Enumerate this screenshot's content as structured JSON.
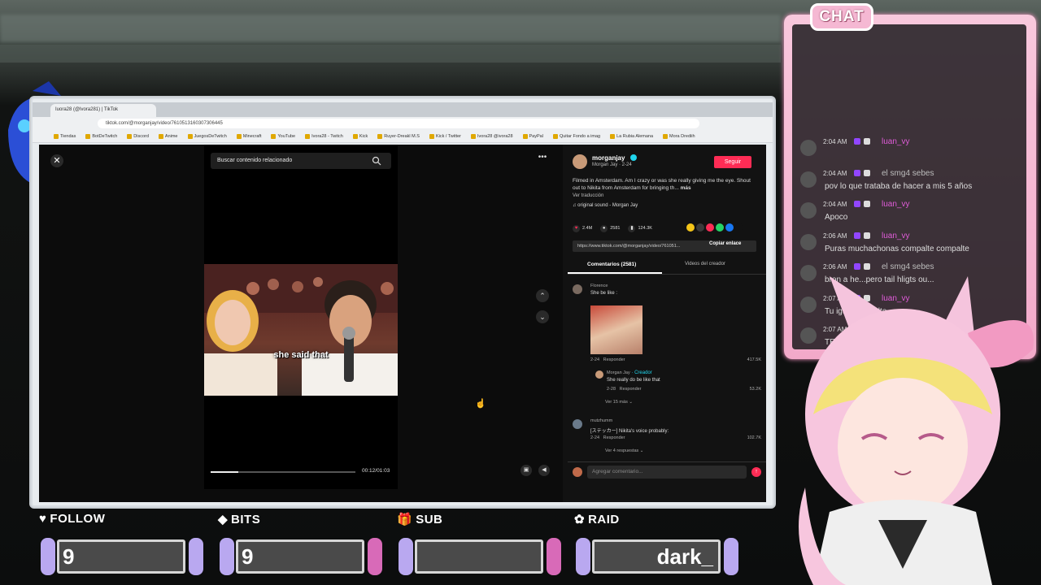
{
  "browser": {
    "tab_title": "Iuora28 (@lvora281) | TikTok",
    "url": "tiktok.com/@morganjay/video/7610513160307306445",
    "bookmarks": [
      "Tiendas",
      "BotDeTwitch",
      "Discord",
      "Anime",
      "JuegosDeTwitch",
      "Minecraft",
      "YouTube",
      "Ivora28 - Twitch",
      "Kick",
      "Ruyer-Dreakl M.S",
      "Kick / Twitter",
      "Ivora28 @ivora28",
      "PayPal",
      "Quitar Fondo a imag",
      "La Rubia Alemana",
      "Mora Drediih"
    ]
  },
  "video": {
    "search_placeholder": "Buscar contenido relacionado",
    "caption": "she said that",
    "time": "00:12/01:03",
    "progress": 0.19
  },
  "post": {
    "username": "morganjay",
    "subline": "Morgan Jay · 2-24",
    "follow": "Seguir",
    "description": "Filmed in Amsterdam. Am I crazy or was she really giving me the eye. Shout out to Nikita from Amsterdam for bringing th...",
    "more": "más",
    "translate": "Ver traducción",
    "sound": "original sound - Morgan Jay",
    "likes": "2.4M",
    "comments": "2581",
    "saves": "124.3K",
    "link": "https://www.tiktok.com/@morganjay/video/761051...",
    "copy": "Copiar enlace",
    "tab_comments": "Comentarios (2581)",
    "tab_videos": "Videos del creador"
  },
  "comments": [
    {
      "name": "Florence",
      "text": "She be like :",
      "date": "2-24",
      "reply": "Responder",
      "likes": "417.5K"
    },
    {
      "name": "Morgan Jay",
      "creator": "· Creador",
      "text": "She really do be like that",
      "date": "2-28",
      "reply": "Responder",
      "likes": "53.2K",
      "more": "Ver 15 más"
    },
    {
      "name": "mutzhumm",
      "text": "[ステッカー] Nikita's voice probably:",
      "date": "2-24",
      "reply": "Responder",
      "likes": "102.7K",
      "more": "Ver 4 respuestas"
    }
  ],
  "input_placeholder": "Agregar comentario...",
  "chat": {
    "title": "CHAT",
    "lines": [
      {
        "time": "2:04 AM",
        "user": "luan_vy",
        "color": "#e05cd9",
        "msg": ""
      },
      {
        "time": "2:04 AM",
        "user": "el smg4 sebes",
        "color": "#bdbdbd",
        "msg": "pov lo que trataba de hacer a mis 5 años"
      },
      {
        "time": "2:04 AM",
        "user": "luan_vy",
        "color": "#e05cd9",
        "msg": "Apoco"
      },
      {
        "time": "2:06 AM",
        "user": "luan_vy",
        "color": "#e05cd9",
        "msg": "Puras muchachonas compalte compalte"
      },
      {
        "time": "2:06 AM",
        "user": "el smg4 sebes",
        "color": "#bdbdbd",
        "msg": "bron a he...pero tail hligts ou..."
      },
      {
        "time": "2:07 AM",
        "user": "luan_vy",
        "color": "#e05cd9",
        "msg": "Tu igu...compalte"
      },
      {
        "time": "2:07 AM",
        "user": "",
        "color": "#bdbdbd",
        "msg": "TE ..."
      }
    ]
  },
  "widgets": [
    {
      "label": "FOLLOW",
      "icon": "♥",
      "value": "9",
      "right_color": "#b9a8f0"
    },
    {
      "label": "BITS",
      "icon": "◆",
      "value": "9",
      "right_color": "#d86ab8"
    },
    {
      "label": "SUB",
      "icon": "🎁",
      "value": "",
      "right_color": "#d86ab8"
    },
    {
      "label": "RAID",
      "icon": "✿",
      "value": "dark_",
      "right_color": "#b9a8f0"
    }
  ]
}
